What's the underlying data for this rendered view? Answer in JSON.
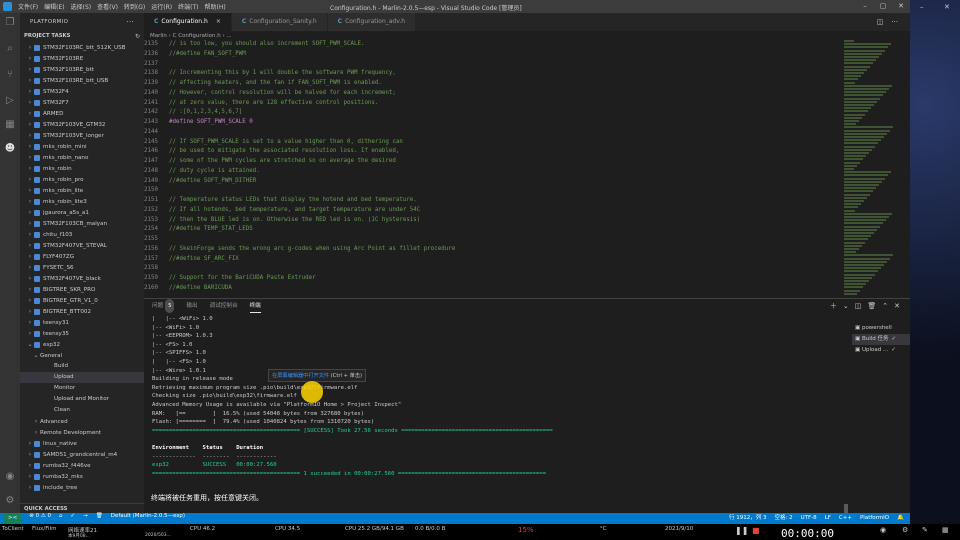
{
  "titlebar": {
    "menu": [
      "文件(F)",
      "编辑(E)",
      "选择(S)",
      "查看(V)",
      "转到(G)",
      "运行(R)",
      "终端(T)",
      "帮助(H)"
    ],
    "title": "Configuration.h - Marlin-2.0.5—esp - Visual Studio Code [管理员]"
  },
  "sidebar": {
    "header": "PLATFORMIO",
    "section": "PROJECT TASKS",
    "items": [
      {
        "label": "STM32F103RC_btt_512K_USB",
        "level": 0,
        "chev": "›"
      },
      {
        "label": "STM32F103RE",
        "level": 0,
        "chev": "›"
      },
      {
        "label": "STM32F103RE_btt",
        "level": 0,
        "chev": "›"
      },
      {
        "label": "STM32F103RE_btt_USB",
        "level": 0,
        "chev": "›"
      },
      {
        "label": "STM32F4",
        "level": 0,
        "chev": "›"
      },
      {
        "label": "STM32F7",
        "level": 0,
        "chev": "›"
      },
      {
        "label": "ARMED",
        "level": 0,
        "chev": "›"
      },
      {
        "label": "STM32F103VE_GTM32",
        "level": 0,
        "chev": "›"
      },
      {
        "label": "STM32F103VE_longer",
        "level": 0,
        "chev": "›"
      },
      {
        "label": "mks_robin_mini",
        "level": 0,
        "chev": "›"
      },
      {
        "label": "mks_robin_nano",
        "level": 0,
        "chev": "›"
      },
      {
        "label": "mks_robin",
        "level": 0,
        "chev": "›"
      },
      {
        "label": "mks_robin_pro",
        "level": 0,
        "chev": "›"
      },
      {
        "label": "mks_robin_lite",
        "level": 0,
        "chev": "›"
      },
      {
        "label": "mks_robin_lite3",
        "level": 0,
        "chev": "›"
      },
      {
        "label": "jgaurora_a5s_a1",
        "level": 0,
        "chev": "›"
      },
      {
        "label": "STM32F103CB_malyan",
        "level": 0,
        "chev": "›"
      },
      {
        "label": "chitu_f103",
        "level": 0,
        "chev": "›"
      },
      {
        "label": "STM32F407VE_STEVAL",
        "level": 0,
        "chev": "›"
      },
      {
        "label": "FLYF407ZG",
        "level": 0,
        "chev": "›"
      },
      {
        "label": "FYSETC_S6",
        "level": 0,
        "chev": "›"
      },
      {
        "label": "STM32F407VE_black",
        "level": 0,
        "chev": "›"
      },
      {
        "label": "BIGTREE_SKR_PRO",
        "level": 0,
        "chev": "›"
      },
      {
        "label": "BIGTREE_GTR_V1_0",
        "level": 0,
        "chev": "›"
      },
      {
        "label": "BIGTREE_BTT002",
        "level": 0,
        "chev": "›"
      },
      {
        "label": "teensy31",
        "level": 0,
        "chev": "›"
      },
      {
        "label": "teensy35",
        "level": 0,
        "chev": "›"
      },
      {
        "label": "esp32",
        "level": 0,
        "chev": "⌄"
      },
      {
        "label": "General",
        "level": 1,
        "chev": "⌄"
      },
      {
        "label": "Build",
        "level": 2,
        "chev": ""
      },
      {
        "label": "Upload",
        "level": 2,
        "chev": "",
        "selected": true
      },
      {
        "label": "Monitor",
        "level": 2,
        "chev": ""
      },
      {
        "label": "Upload and Monitor",
        "level": 2,
        "chev": ""
      },
      {
        "label": "Clean",
        "level": 2,
        "chev": ""
      },
      {
        "label": "Advanced",
        "level": 1,
        "chev": "›"
      },
      {
        "label": "Remote Development",
        "level": 1,
        "chev": "›"
      },
      {
        "label": "linux_native",
        "level": 0,
        "chev": "›"
      },
      {
        "label": "SAMD51_grandcentral_m4",
        "level": 0,
        "chev": "›"
      },
      {
        "label": "rumba32_f446ve",
        "level": 0,
        "chev": "›"
      },
      {
        "label": "rumba32_mks",
        "level": 0,
        "chev": "›"
      },
      {
        "label": "include_tree",
        "level": 0,
        "chev": "›"
      }
    ],
    "bottom_section": "QUICK ACCESS"
  },
  "tabs": [
    {
      "label": "Configuration.h",
      "active": true
    },
    {
      "label": "Configuration_Sanity.h",
      "active": false
    },
    {
      "label": "Configuration_adv.h",
      "active": false
    }
  ],
  "breadcrumb": "Marlin  ›  C  Configuration.h  ›  ...",
  "code": [
    {
      "n": "2135",
      "t": "// is too low, you should also increment SOFT_PWM_SCALE.",
      "k": "cm"
    },
    {
      "n": "2136",
      "t": "//#define FAN_SOFT_PWM",
      "k": "cm"
    },
    {
      "n": "2137",
      "t": "",
      "k": ""
    },
    {
      "n": "2138",
      "t": "// Incrementing this by 1 will double the software PWM frequency,",
      "k": "cm"
    },
    {
      "n": "2139",
      "t": "// affecting heaters, and the fan if FAN_SOFT_PWM is enabled.",
      "k": "cm"
    },
    {
      "n": "2140",
      "t": "// However, control resolution will be halved for each increment;",
      "k": "cm"
    },
    {
      "n": "2141",
      "t": "// at zero value, there are 128 effective control positions.",
      "k": "cm"
    },
    {
      "n": "2142",
      "t": "// :[0,1,2,3,4,5,6,7]",
      "k": "cm"
    },
    {
      "n": "2143",
      "t": "#define SOFT_PWM_SCALE 0",
      "k": "pp"
    },
    {
      "n": "2144",
      "t": "",
      "k": ""
    },
    {
      "n": "2145",
      "t": "// If SOFT_PWM_SCALE is set to a value higher than 0, dithering can",
      "k": "cm"
    },
    {
      "n": "2146",
      "t": "// be used to mitigate the associated resolution loss. If enabled,",
      "k": "cm"
    },
    {
      "n": "2147",
      "t": "// some of the PWM cycles are stretched so on average the desired",
      "k": "cm"
    },
    {
      "n": "2148",
      "t": "// duty cycle is attained.",
      "k": "cm"
    },
    {
      "n": "2149",
      "t": "//#define SOFT_PWM_DITHER",
      "k": "cm"
    },
    {
      "n": "2150",
      "t": "",
      "k": ""
    },
    {
      "n": "2151",
      "t": "// Temperature status LEDs that display the hotend and bed temperature.",
      "k": "cm"
    },
    {
      "n": "2152",
      "t": "// If all hotends, bed temperature, and target temperature are under 54C",
      "k": "cm"
    },
    {
      "n": "2153",
      "t": "// then the BLUE led is on. Otherwise the RED led is on. (1C hysteresis)",
      "k": "cm"
    },
    {
      "n": "2154",
      "t": "//#define TEMP_STAT_LEDS",
      "k": "cm"
    },
    {
      "n": "2155",
      "t": "",
      "k": ""
    },
    {
      "n": "2156",
      "t": "// SkeinForge sends the wrong arc g-codes when using Arc Point as fillet procedure",
      "k": "cm"
    },
    {
      "n": "2157",
      "t": "//#define SF_ARC_FIX",
      "k": "cm"
    },
    {
      "n": "2158",
      "t": "",
      "k": ""
    },
    {
      "n": "2159",
      "t": "// Support for the BariCUDA Paste Extruder",
      "k": "cm"
    },
    {
      "n": "2160",
      "t": "//#define BARICUDA",
      "k": "cm"
    }
  ],
  "panel": {
    "tabs": [
      "问题",
      "输出",
      "调试控制台",
      "终端"
    ],
    "problems_badge": "5",
    "active_tab": 3,
    "terminals": [
      {
        "label": "powershell",
        "selected": false,
        "check": ""
      },
      {
        "label": "Build 任务",
        "selected": true,
        "check": "✓"
      },
      {
        "label": "Upload ...",
        "selected": false,
        "check": "✓"
      }
    ]
  },
  "terminal_lines": [
    {
      "t": "|   |-- <WiFi> 1.0",
      "k": ""
    },
    {
      "t": "|-- <WiFi> 1.0",
      "k": ""
    },
    {
      "t": "|-- <EEPROM> 1.0.3",
      "k": ""
    },
    {
      "t": "|-- <FS> 1.0",
      "k": ""
    },
    {
      "t": "|-- <SPIFFS> 1.0",
      "k": ""
    },
    {
      "t": "|   |-- <FS> 1.0",
      "k": ""
    },
    {
      "t": "|-- <Wire> 1.0.1",
      "k": ""
    },
    {
      "t": "Building in release mode",
      "k": ""
    },
    {
      "t": "Retrieving maximum program size .pio\\build\\esp32\\firmware.elf",
      "k": ""
    },
    {
      "t": "Checking size .pio\\build\\esp32\\firmware.elf",
      "k": ""
    },
    {
      "t": "Advanced Memory Usage is available via \"PlatformIO Home > Project Inspect\"",
      "k": ""
    },
    {
      "t": "RAM:   [==        ]  16.5% (used 54048 bytes from 327680 bytes)",
      "k": ""
    },
    {
      "t": "Flash: [========  ]  79.4% (used 1040824 bytes from 1310720 bytes)",
      "k": ""
    },
    {
      "t": "============================================ [SUCCESS] Took 27.56 seconds =============================================",
      "k": "ok"
    },
    {
      "t": "",
      "k": ""
    },
    {
      "t": "Environment    Status    Duration",
      "k": "hd"
    },
    {
      "t": "-------------  --------  ------------",
      "k": ""
    },
    {
      "t": "esp32          SUCCESS   00:00:27.560",
      "k": "ok"
    },
    {
      "t": "============================================ 1 succeeded in 00:00:27.560 ============================================",
      "k": "ok"
    },
    {
      "t": "",
      "k": ""
    },
    {
      "t": "",
      "k": ""
    }
  ],
  "tooltip": {
    "link_text": "在屏幕编辑器中打开文件",
    "hint": "(Ctrl + 单击)"
  },
  "terminal_message": "终端将被任务重用，按任意键关闭。",
  "statusbar": {
    "remote": "><",
    "errors": "⊗ 0  ⚠ 0",
    "project": "Default (Marlin-2.0.5—esp)",
    "position": "行 1912，列 3",
    "spaces": "空格: 2",
    "encoding": "UTF-8",
    "eol": "LF",
    "language": "C++",
    "platform": "PlatformIO"
  },
  "taskbar": {
    "items": [
      "ToClient",
      "Flux/Film",
      "网络速率21",
      "本9月08...",
      "2020/503..."
    ],
    "mid": [
      "CPU 46.2",
      "CPU 34.5",
      "CPU 25.2 GB/94.1 GB",
      "0.0 B/0.0 B"
    ],
    "percent": "15%",
    "date": "2021/9/10",
    "time": "00:00:00",
    "temp": "°C"
  },
  "colors": {
    "accent": "#007acc",
    "success": "#23d18b",
    "comment": "#6a9955"
  }
}
